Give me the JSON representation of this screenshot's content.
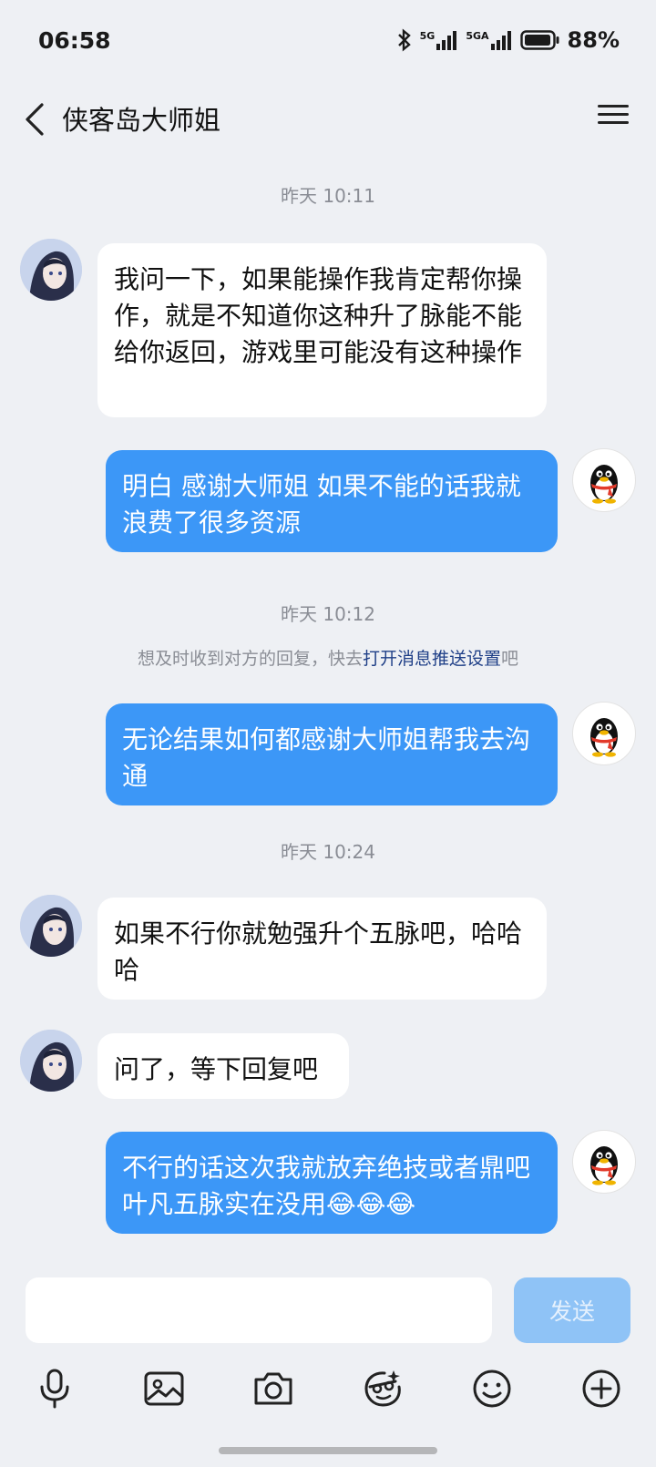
{
  "status_bar": {
    "time": "06:58",
    "battery_percent": "88%",
    "network_1": "5G",
    "network_2": "5GA"
  },
  "header": {
    "title": "侠客岛大师姐"
  },
  "messages": [
    {
      "type": "timestamp",
      "text": "昨天 10:11"
    },
    {
      "type": "incoming",
      "text": "我问一下，如果能操作我肯定帮你操作，就是不知道你这种升了脉能不能给你返回，游戏里可能没有这种操作"
    },
    {
      "type": "outgoing",
      "text": "明白 感谢大师姐 如果不能的话我就浪费了很多资源"
    },
    {
      "type": "timestamp",
      "text": "昨天 10:12"
    },
    {
      "type": "notice",
      "text_before": "想及时收到对方的回复，快去",
      "link": "打开消息推送设置",
      "text_after": "吧"
    },
    {
      "type": "outgoing",
      "text": "无论结果如何都感谢大师姐帮我去沟通"
    },
    {
      "type": "timestamp",
      "text": "昨天 10:24"
    },
    {
      "type": "incoming",
      "text": "如果不行你就勉强升个五脉吧，哈哈哈"
    },
    {
      "type": "incoming",
      "text": "问了，等下回复吧"
    },
    {
      "type": "outgoing",
      "text": "不行的话这次我就放弃绝技或者鼎吧 叶凡五脉实在没用😂😂😂"
    }
  ],
  "input": {
    "value": "",
    "placeholder": "",
    "send_label": "发送"
  },
  "toolbar": {
    "icons": [
      "microphone-icon",
      "image-icon",
      "camera-icon",
      "sticker-icon",
      "emoji-icon",
      "plus-icon"
    ]
  },
  "colors": {
    "background": "#eef0f4",
    "outgoing_bubble": "#3c97f7",
    "incoming_bubble": "#ffffff",
    "link": "#1f3f87",
    "send_button": "#8fc3f6"
  }
}
